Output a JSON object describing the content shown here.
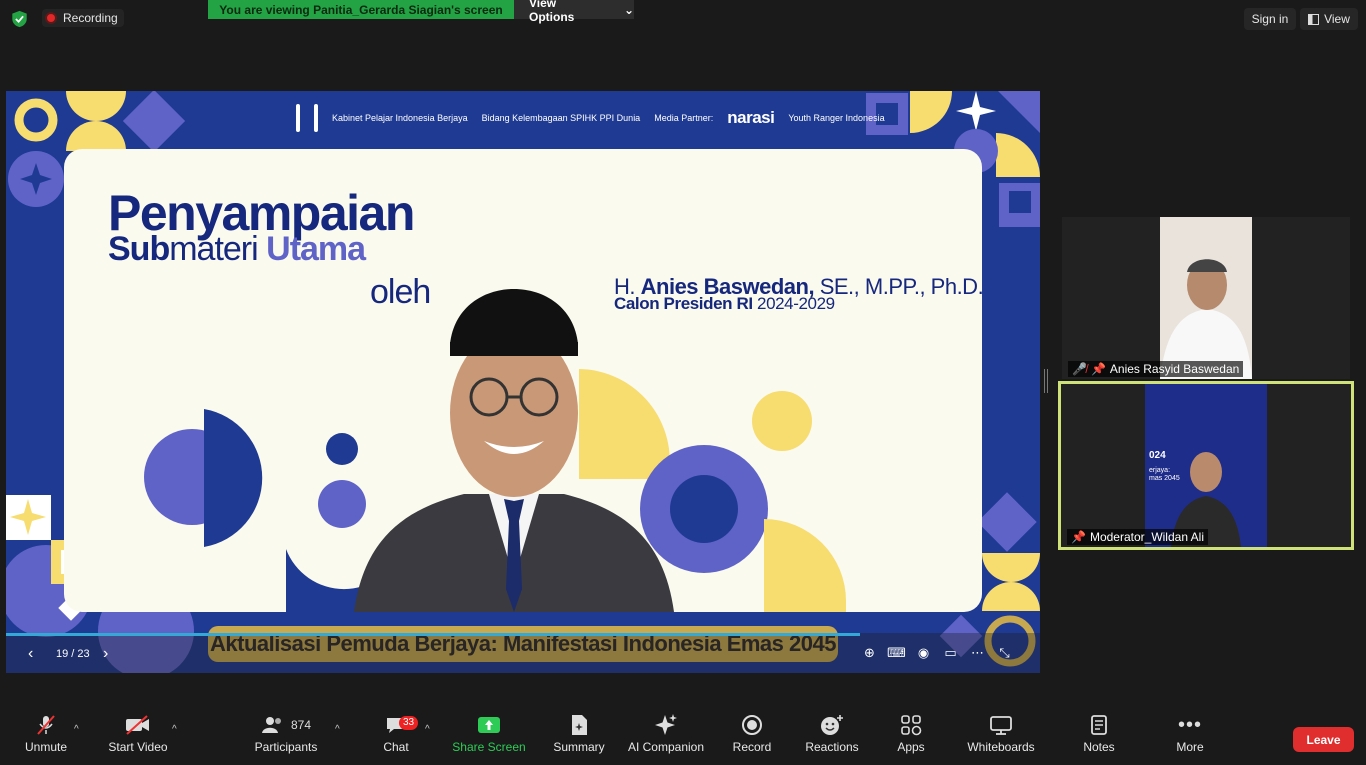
{
  "topbar": {
    "recording_label": "Recording",
    "viewing_banner": "You are viewing Panitia_Gerarda Siagian's screen",
    "view_options_label": "View Options",
    "sign_in_label": "Sign in",
    "view_label": "View"
  },
  "slide": {
    "logos": {
      "kabinet": "Kabinet Pelajar Indonesia Berjaya",
      "bidang": "Bidang Kelembagaan SPIHK PPI Dunia",
      "media": "Media Partner:",
      "narasi": "narasi",
      "youth": "Youth Ranger Indonesia"
    },
    "title_main": "Penyampaian",
    "title_sub_bold": "Sub",
    "title_sub_regular": "materi ",
    "title_sub_accent": "Utama",
    "oleh": "oleh",
    "speaker_prefix": "H. ",
    "speaker_name": "Anies Baswedan,",
    "speaker_degrees": " SE., M.PP., Ph.D.",
    "speaker_role_bold": "Calon Presiden RI",
    "speaker_role_years": " 2024-2029",
    "footer_theme": "Aktualisasi Pemuda Berjaya: Manifestasi Indonesia Emas 2045",
    "colors": {
      "navy": "#1f3a93",
      "periwinkle": "#5f63c8",
      "yellow": "#f7dc6f",
      "cream": "#fbfaee"
    }
  },
  "slide_controls": {
    "page_indicator": "19 / 23",
    "progress": 0.826,
    "icons": [
      "zoom-in-icon",
      "keyboard-icon",
      "broadcast-icon",
      "screen-icon",
      "more-icon",
      "exit-fullscreen-icon"
    ]
  },
  "participants_video": [
    {
      "name": "Anies Rasyid Baswedan",
      "muted": true,
      "pinned": true
    },
    {
      "name": "Moderator_Wildan Ali",
      "muted": false,
      "pinned": true,
      "active_speaker": true
    }
  ],
  "toolbar": {
    "unmute": "Unmute",
    "start_video": "Start Video",
    "participants": "Participants",
    "participants_count": "874",
    "chat": "Chat",
    "chat_badge": "33",
    "share_screen": "Share Screen",
    "summary": "Summary",
    "ai_companion": "AI Companion",
    "record": "Record",
    "reactions": "Reactions",
    "apps": "Apps",
    "whiteboards": "Whiteboards",
    "notes": "Notes",
    "more": "More",
    "leave": "Leave",
    "accent_green": "#2ecc57",
    "leave_red": "#e02d2d"
  }
}
